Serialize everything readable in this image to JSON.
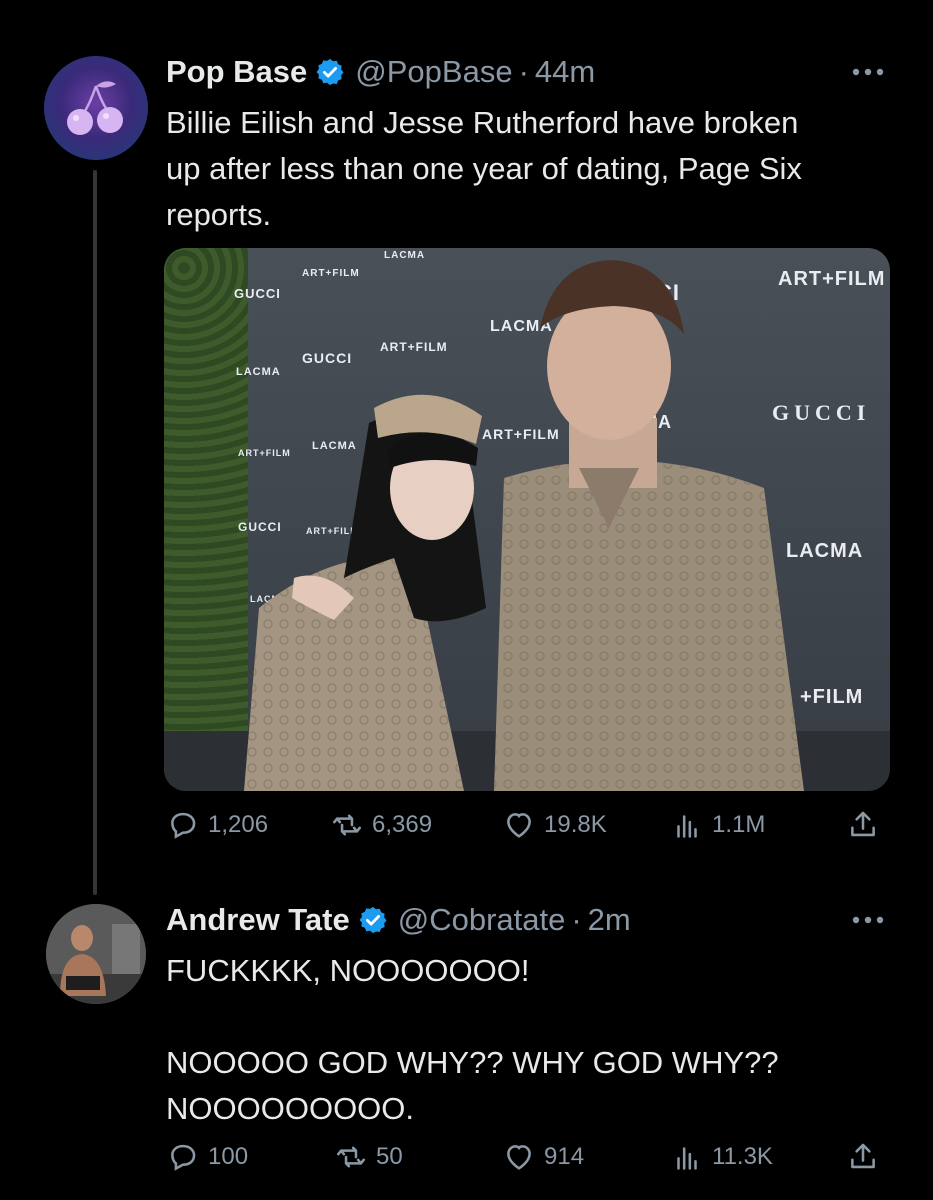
{
  "tweets": [
    {
      "author": "Pop Base",
      "handle": "@PopBase",
      "separator": "·",
      "time": "44m",
      "text": "Billie Eilish and Jesse Rutherford have broken\nup after less than one year of dating, Page Six\nreports.",
      "media_text": {
        "gucci_1": "GUCCI",
        "artfilm_1": "ART+FILM",
        "lacma_top": "LACMA",
        "gucci_2": "GUCCI",
        "artfilm_2": "ART+FILM",
        "lacma_1": "LACMA",
        "lacma_2": "LACMA",
        "artfilm_3": "ART+FILM",
        "lacma_3": "LACMA",
        "artfilm_4": "ART+FILM",
        "gucci_3": "GUCCI",
        "artfilm_5": "ART+FILM",
        "lacma_4": "LACMA",
        "ci": "CI",
        "artfilm_big": "ART+FILM",
        "ma": "MA",
        "gucci_big": "GUCCI",
        "lacma_big": "LACMA",
        "film_big": "+FILM"
      },
      "stats": {
        "replies": "1,206",
        "retweets": "6,369",
        "likes": "19.8K",
        "views": "1.1M"
      }
    },
    {
      "author": "Andrew Tate",
      "handle": "@Cobratate",
      "separator": "·",
      "time": "2m",
      "text": "FUCKKKK, NOOOOOOO!\n\nNOOOOO GOD WHY?? WHY GOD WHY??\nNOOOOOOOOO.",
      "stats": {
        "replies": "100",
        "retweets": "50",
        "likes": "914",
        "views": "11.3K"
      }
    }
  ],
  "icons": {
    "verified": "verified-badge-icon",
    "more": "more-dots-icon",
    "reply": "reply-icon",
    "retweet": "retweet-icon",
    "like": "heart-icon",
    "views": "views-icon",
    "share": "share-icon"
  },
  "colors": {
    "background": "#000000",
    "text": "#e7e9ea",
    "muted": "#8b98a5",
    "verified": "#1d9bf0",
    "thread_line": "#333639"
  }
}
